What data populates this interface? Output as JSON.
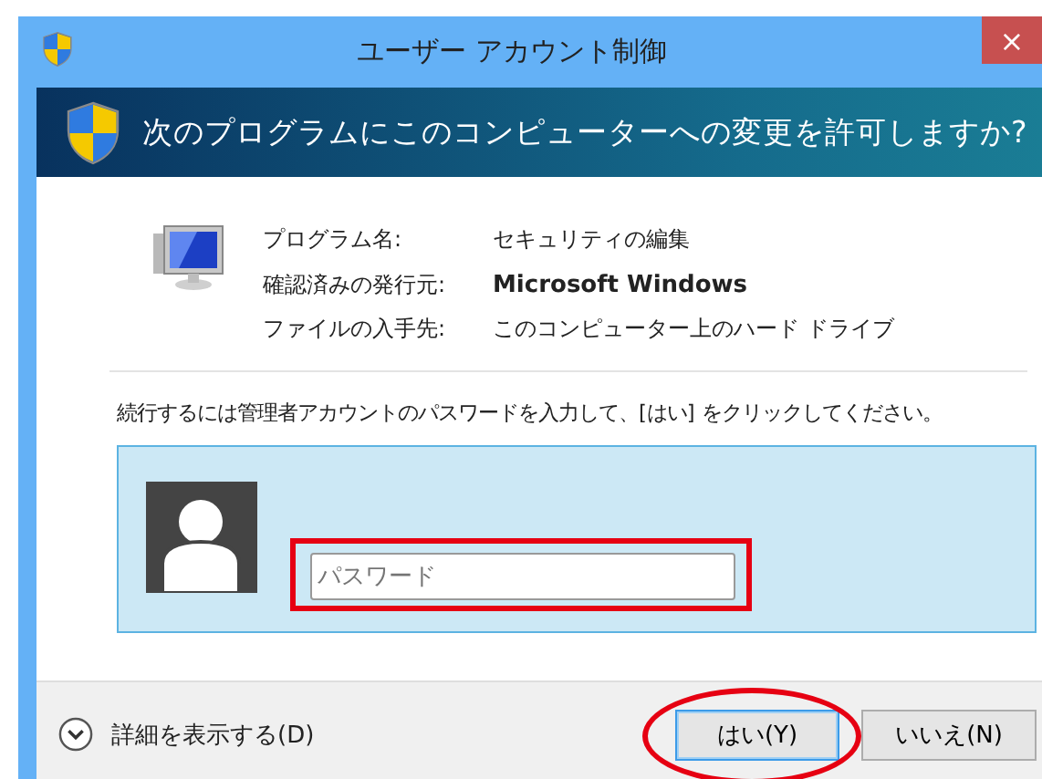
{
  "window": {
    "title": "ユーザー アカウント制御",
    "close": "×"
  },
  "header": {
    "question": "次のプログラムにこのコンピューターへの変更を許可しますか?"
  },
  "details": [
    {
      "label": "プログラム名:",
      "value": "セキュリティの編集",
      "bold": false
    },
    {
      "label": "確認済みの発行元:",
      "value": "Microsoft Windows",
      "bold": true
    },
    {
      "label": "ファイルの入手先:",
      "value": "このコンピューター上のハード ドライブ",
      "bold": false
    }
  ],
  "instruction": "続行するには管理者アカウントのパスワードを入力して、[はい] をクリックしてください。",
  "password_field": {
    "placeholder": "パスワード",
    "marked": true
  },
  "footer": {
    "details_toggle": "詳細を表示する(D)",
    "expanded": false
  },
  "buttons": [
    {
      "label": "はい(Y)",
      "default": true,
      "marked": true
    },
    {
      "label": "いいえ(N)",
      "default": false,
      "marked": false
    }
  ]
}
